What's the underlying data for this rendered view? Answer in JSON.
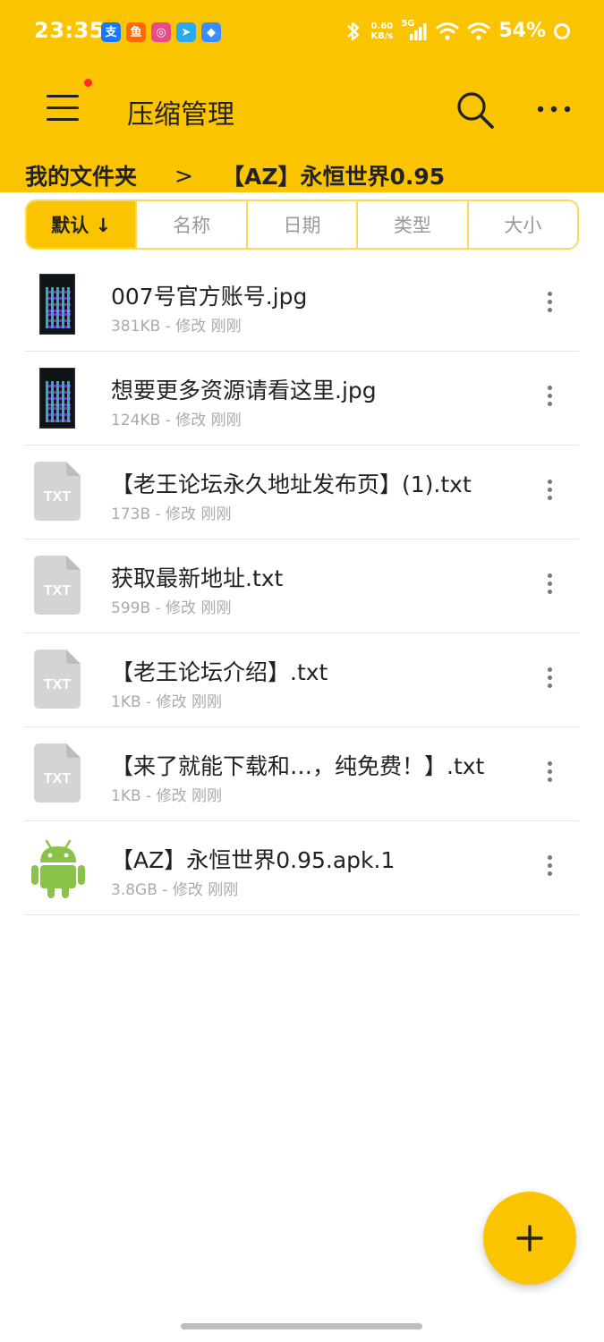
{
  "status_bar": {
    "time": "23:35",
    "net_speed_value": "0.60",
    "net_speed_unit": "KB/s",
    "signal_label": "5G",
    "battery": "54%",
    "notification_apps": [
      {
        "icon": "alipay-icon",
        "glyph": "支",
        "color": "#1677FF"
      },
      {
        "icon": "xianyu-icon",
        "glyph": "鱼",
        "color": "#FF6A00"
      },
      {
        "icon": "app-icon",
        "glyph": "◎",
        "color": "#E94B8A"
      },
      {
        "icon": "telegram-icon",
        "glyph": "➤",
        "color": "#2AABEE"
      },
      {
        "icon": "app-icon-2",
        "glyph": "◆",
        "color": "#3A8DFF"
      }
    ]
  },
  "header": {
    "title": "压缩管理",
    "breadcrumb": {
      "root": "我的文件夹",
      "separator": ">",
      "current": "【AZ】永恒世界0.95"
    }
  },
  "sort_tabs": [
    {
      "label": "默认 ↓",
      "active": true
    },
    {
      "label": "名称",
      "active": false
    },
    {
      "label": "日期",
      "active": false
    },
    {
      "label": "类型",
      "active": false
    },
    {
      "label": "大小",
      "active": false
    }
  ],
  "files": [
    {
      "name": "007号官方账号.jpg",
      "meta": "381KB - 修改 刚刚",
      "type": "image"
    },
    {
      "name": "想要更多资源请看这里.jpg",
      "meta": "124KB - 修改 刚刚",
      "type": "image"
    },
    {
      "name": "【老王论坛永久地址发布页】(1).txt",
      "meta": "173B - 修改 刚刚",
      "type": "txt",
      "icon_label": "TXT"
    },
    {
      "name": "获取最新地址.txt",
      "meta": "599B - 修改 刚刚",
      "type": "txt",
      "icon_label": "TXT"
    },
    {
      "name": "【老王论坛介绍】.txt",
      "meta": "1KB - 修改 刚刚",
      "type": "txt",
      "icon_label": "TXT"
    },
    {
      "name": "【来了就能下载和…，纯免费！】.txt",
      "meta": "1KB - 修改 刚刚",
      "type": "txt",
      "icon_label": "TXT"
    },
    {
      "name": "【AZ】永恒世界0.95.apk.1",
      "meta": "3.8GB - 修改 刚刚",
      "type": "apk"
    }
  ],
  "colors": {
    "accent": "#FBC400",
    "android_green": "#8BC34A",
    "txt_icon_gray": "#D4D4D4",
    "badge_red": "#FF2A2A"
  }
}
